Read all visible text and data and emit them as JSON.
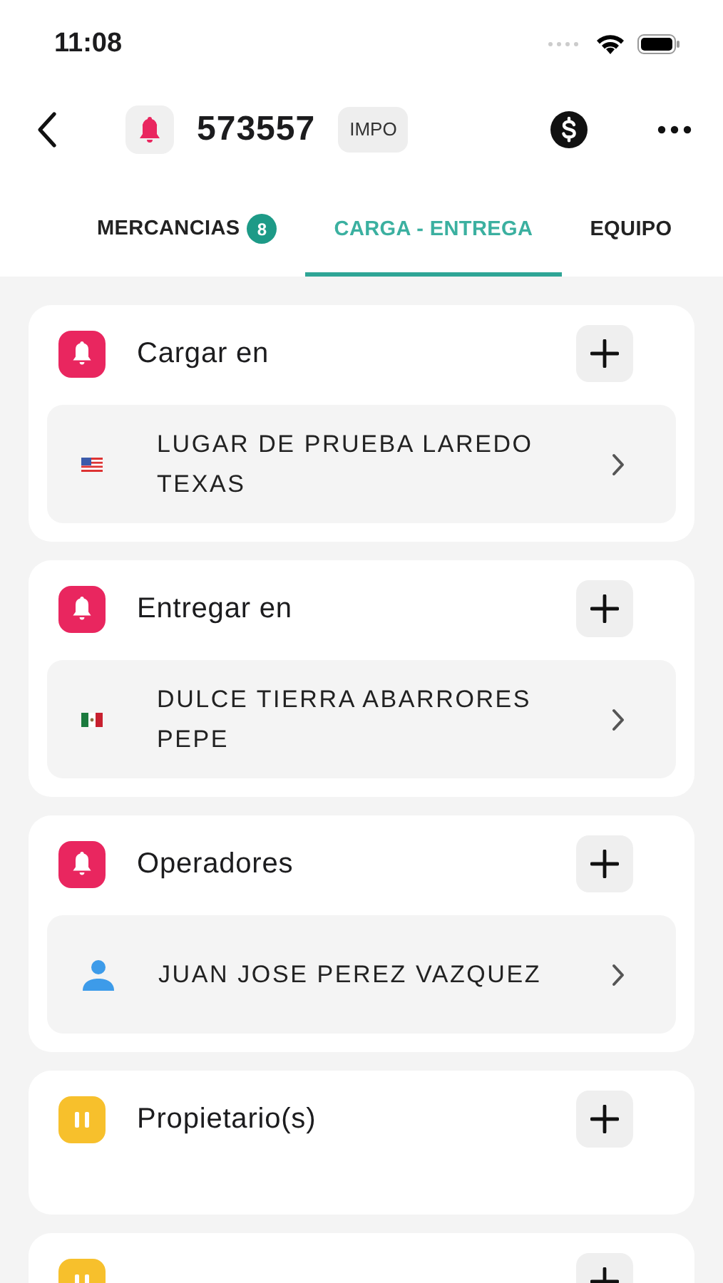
{
  "status_bar": {
    "time": "11:08"
  },
  "header": {
    "number": "573557",
    "tag": "IMPO"
  },
  "tabs": [
    {
      "label": "MERCANCIAS",
      "badge": "8",
      "selected": false
    },
    {
      "label": "CARGA - ENTREGA",
      "selected": true
    },
    {
      "label": "EQUIPO",
      "selected": false
    }
  ],
  "sections": [
    {
      "title": "Cargar en",
      "kind": "alert",
      "items": [
        {
          "kind": "flag-us",
          "text": "LUGAR DE PRUEBA LAREDO TEXAS"
        }
      ]
    },
    {
      "title": "Entregar en",
      "kind": "alert",
      "items": [
        {
          "kind": "flag-mx",
          "text": "DULCE TIERRA ABARRORES PEPE"
        }
      ]
    },
    {
      "title": "Operadores",
      "kind": "alert",
      "items": [
        {
          "kind": "person",
          "text": "JUAN JOSE PEREZ VAZQUEZ"
        }
      ]
    },
    {
      "title": "Propietario(s)",
      "kind": "paused"
    },
    {
      "kind": "paused"
    }
  ]
}
